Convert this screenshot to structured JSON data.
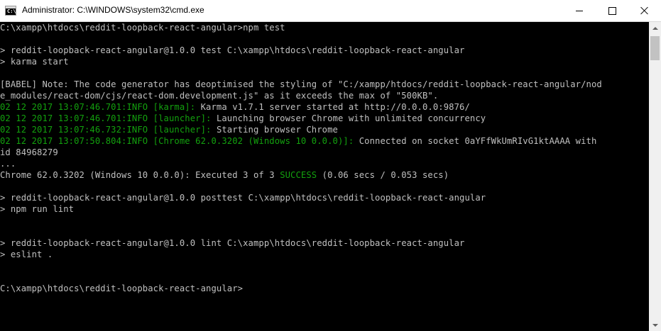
{
  "window": {
    "title": "Administrator: C:\\WINDOWS\\system32\\cmd.exe",
    "icon_text": "C:\\",
    "icon": "cmd-icon",
    "controls": {
      "minimize": "minimize-icon",
      "maximize": "maximize-icon",
      "close": "close-icon"
    }
  },
  "colors": {
    "background": "#000000",
    "text": "#c0c0c0",
    "green": "#13a10e",
    "titlebar": "#ffffff"
  },
  "console": {
    "l01": "C:\\xampp\\htdocs\\reddit-loopback-react-angular>npm test",
    "l02": "> reddit-loopback-react-angular@1.0.0 test C:\\xampp\\htdocs\\reddit-loopback-react-angular",
    "l03": "> karma start",
    "l04": "[BABEL] Note: The code generator has deoptimised the styling of \"C:/xampp/htdocs/reddit-loopback-react-angular/nod",
    "l05": "e_modules/react-dom/cjs/react-dom.development.js\" as it exceeds the max of \"500KB\".",
    "l06_green": "02 12 2017 13:07:46.701:INFO [karma]: ",
    "l06_rest": "Karma v1.7.1 server started at http://0.0.0.0:9876/",
    "l07_green": "02 12 2017 13:07:46.701:INFO [launcher]: ",
    "l07_rest": "Launching browser Chrome with unlimited concurrency",
    "l08_green": "02 12 2017 13:07:46.732:INFO [launcher]: ",
    "l08_rest": "Starting browser Chrome",
    "l09_green": "02 12 2017 13:07:50.804:INFO [Chrome 62.0.3202 (Windows 10 0.0.0)]: ",
    "l09_rest": "Connected on socket 0aYFfWkUmRIvG1ktAAAA with",
    "l10": "id 84968279",
    "l11": "...",
    "l12_a": "Chrome 62.0.3202 (Windows 10 0.0.0): Executed 3 of 3 ",
    "l12_success": "SUCCESS",
    "l12_b": " (0.06 secs / 0.053 secs)",
    "l13": "> reddit-loopback-react-angular@1.0.0 posttest C:\\xampp\\htdocs\\reddit-loopback-react-angular",
    "l14": "> npm run lint",
    "l15": "> reddit-loopback-react-angular@1.0.0 lint C:\\xampp\\htdocs\\reddit-loopback-react-angular",
    "l16": "> eslint .",
    "l17": "C:\\xampp\\htdocs\\reddit-loopback-react-angular>"
  },
  "scrollbar": {
    "up": "scroll-up-arrow-icon",
    "down": "scroll-down-arrow-icon"
  }
}
